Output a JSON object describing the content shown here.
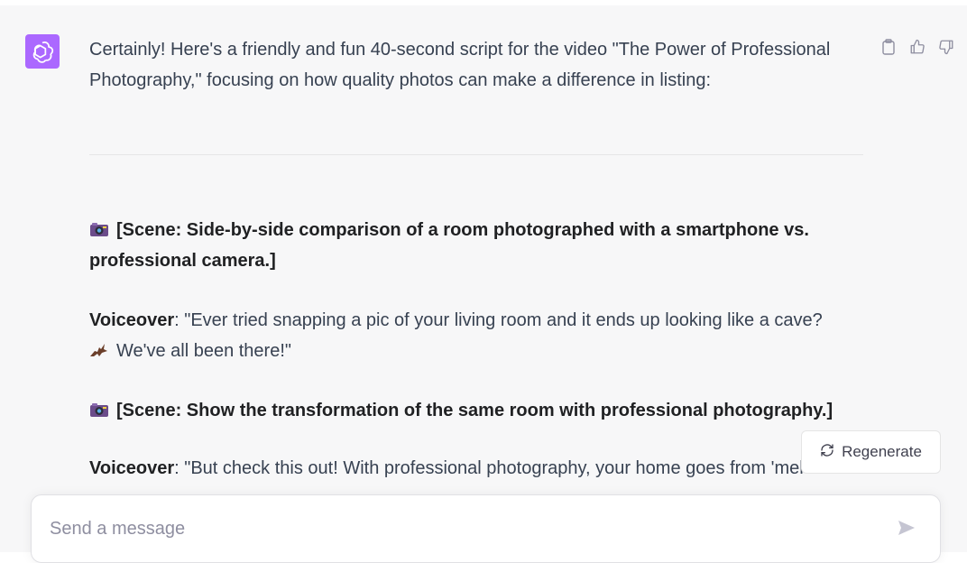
{
  "message": {
    "intro_line1": "Certainly! Here's a friendly and fun 40-second script for the video \"The Power of Professional",
    "intro_line2": "Photography,\" focusing on how quality photos can make a difference in listing:",
    "scene1_line1": "[Scene: Side-by-side comparison of a room photographed with a smartphone vs.",
    "scene1_line2": "professional camera.]",
    "voiceover1_label": "Voiceover",
    "voiceover1_text_line1": ": \"Ever tried snapping a pic of your living room and it ends up looking like a cave?",
    "voiceover1_text_line2": "We've all been there!\"",
    "scene2": "[Scene: Show the transformation of the same room with professional photography.]",
    "voiceover2_label": "Voiceover",
    "voiceover2_text": ": \"But check this out! With professional photography, your home goes from 'meh' to"
  },
  "icons": {
    "avatar": "openai-logo-icon",
    "copy": "clipboard-icon",
    "like": "thumbs-up-icon",
    "dislike": "thumbs-down-icon",
    "scene_emoji": "camera-with-flash-icon",
    "bat_emoji": "bat-icon",
    "regenerate": "refresh-icon",
    "send": "send-icon"
  },
  "regenerate_label": "Regenerate",
  "input": {
    "placeholder": "Send a message",
    "value": ""
  },
  "colors": {
    "avatar_bg": "#ab68ff",
    "message_bg": "#f7f7f8"
  }
}
